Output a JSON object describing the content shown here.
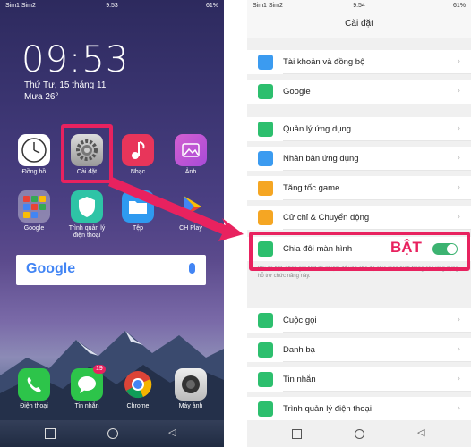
{
  "left_screen": {
    "status": {
      "carrier": "Sim1 Sim2",
      "time": "9:53",
      "battery": "61%"
    },
    "clock": "09:53",
    "date": "Thứ Tư, 15 tháng 11",
    "weather": "Mưa 26°",
    "apps_row1": [
      "Đồng hồ",
      "Cài đặt",
      "Nhạc",
      "Ảnh"
    ],
    "apps_row2": [
      "Google",
      "Trình quản lý điện thoại",
      "Tệp",
      "CH Play"
    ],
    "search_logo": "Google",
    "dock": [
      "Điện thoại",
      "Tin nhắn",
      "Chrome",
      "Máy ảnh"
    ],
    "messages_badge": "19"
  },
  "right_screen": {
    "status": {
      "carrier": "Sim1 Sim2",
      "time": "9:54",
      "battery": "61%"
    },
    "title": "Cài đặt",
    "group1": [
      "Tài khoản và đồng bộ",
      "Google"
    ],
    "group2": [
      "Quản lý ứng dụng",
      "Nhân bản ứng dụng",
      "Tăng tốc game",
      "Cử chỉ & Chuyển động",
      "Chia đôi màn hình"
    ],
    "split_note": "Khi đã bật, nhấn giữ Nút đa nhiệm để vào chế độ chia màn hình trong các ứng dụng hỗ trợ chức năng này.",
    "group3": [
      "Cuộc gọi",
      "Danh bạ",
      "Tin nhắn",
      "Trình quản lý điện thoại"
    ]
  },
  "annotation": {
    "on_label": "BẬT"
  },
  "colors": {
    "highlight": "#e8225f",
    "toggle_on": "#3cb371"
  }
}
